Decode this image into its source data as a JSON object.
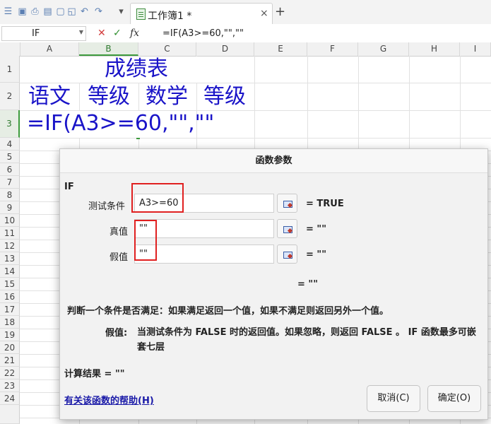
{
  "toolbar": {
    "icons": [
      "app-menu-icon",
      "save-icon",
      "print-preview-icon",
      "print-icon",
      "export-pdf-icon",
      "undo-icon",
      "redo-icon",
      "more-icon"
    ]
  },
  "tab": {
    "title": "工作簿1 *",
    "close": "×",
    "new_tab": "+"
  },
  "formula_bar": {
    "name_box": "IF",
    "cancel": "✕",
    "confirm": "✓",
    "fx": "fx",
    "formula": "=IF(A3>=60,\"\",\"\""
  },
  "columns": [
    "A",
    "B",
    "C",
    "D",
    "E",
    "F",
    "G",
    "H",
    "I"
  ],
  "rows": [
    "1",
    "2",
    "3",
    "4",
    "5",
    "6",
    "7",
    "8",
    "9",
    "10",
    "11",
    "12",
    "13",
    "14",
    "15",
    "16",
    "17",
    "18",
    "19",
    "20",
    "21",
    "22",
    "23",
    "24"
  ],
  "cells": {
    "title": "成绩表",
    "a2": "语文",
    "b2": "等级",
    "c2": "数学",
    "d2": "等级",
    "a3": "=IF(A3>=60,\"\",\"\""
  },
  "dialog": {
    "title": "函数参数",
    "function_name": "IF",
    "args": [
      {
        "label": "测试条件",
        "value": "A3>=60",
        "result": "= TRUE"
      },
      {
        "label": "真值",
        "value": "\"\"",
        "result": "= \"\""
      },
      {
        "label": "假值",
        "value": "\"\"",
        "result": "= \"\""
      }
    ],
    "overall_result": "= \"\"",
    "description": "判断一个条件是否满足：如果满足返回一个值，如果不满足则返回另外一个值。",
    "arg_desc_label": "假值:",
    "arg_desc_text": "当测试条件为 FALSE 时的返回值。如果忽略，则返回 FALSE 。 IF 函数最多可嵌套七层",
    "calc_result": "计算结果 = \"\"",
    "help_link": "有关该函数的帮助(H)",
    "cancel_button": "取消(C)",
    "ok_button": "确定(O)"
  },
  "colors": {
    "accent_green": "#3d9b3d",
    "cell_text_blue": "#1a14c8",
    "highlight_red": "#e02020"
  }
}
